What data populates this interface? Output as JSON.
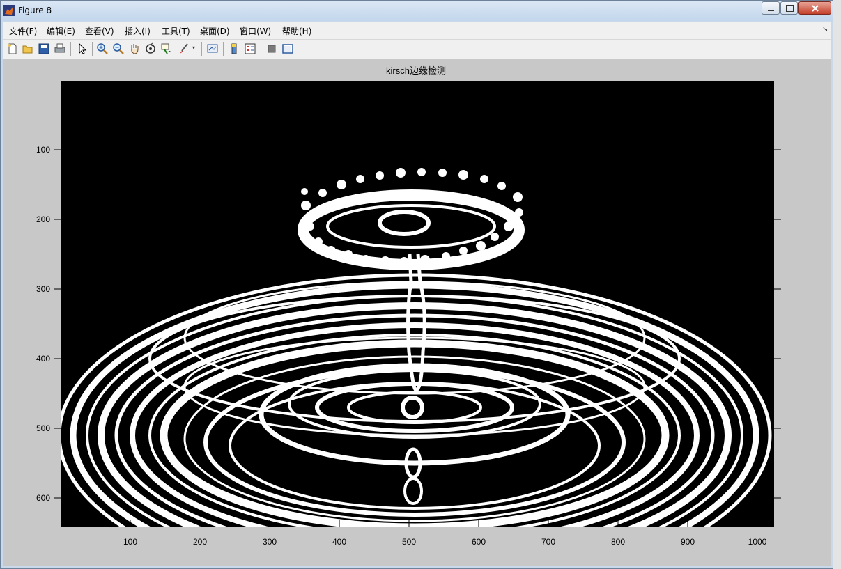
{
  "window": {
    "title": "Figure 8"
  },
  "menu": {
    "items": [
      "文件(F)",
      "编辑(E)",
      "查看(V)",
      "插入(I)",
      "工具(T)",
      "桌面(D)",
      "窗口(W)",
      "帮助(H)"
    ]
  },
  "plot": {
    "title": "kirsch边缘检测",
    "x_ticks": [
      "100",
      "200",
      "300",
      "400",
      "500",
      "600",
      "700",
      "800",
      "900",
      "1000"
    ],
    "y_ticks": [
      "100",
      "200",
      "300",
      "400",
      "500",
      "600"
    ]
  },
  "colors": {
    "image_background": "#000000",
    "edges": "#ffffff",
    "figure_background": "#c8c8c8"
  }
}
